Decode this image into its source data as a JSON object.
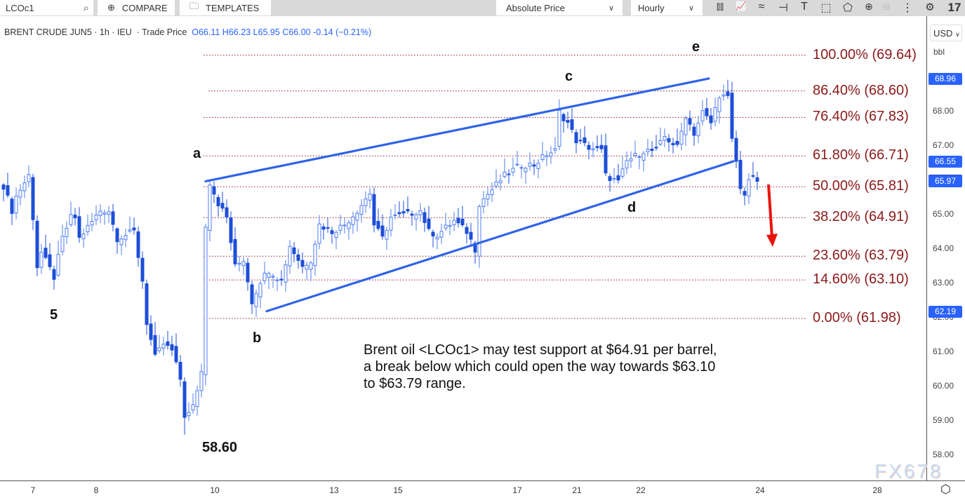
{
  "toolbar": {
    "symbol": "LCOc1",
    "compare": "COMPARE",
    "templates": "TEMPLATES",
    "price_mode": "Absolute Price",
    "interval": "Hourly",
    "icons": [
      "candlestick-icon",
      "indicator-icon",
      "studies-icon",
      "horizontal-line-icon",
      "text-icon",
      "rectangle-icon",
      "polygon-icon",
      "zoom-in-icon",
      "zoom-out-icon",
      "more-icon",
      "settings-icon",
      "tradingview-logo-icon"
    ]
  },
  "legend": {
    "name": "BRENT CRUDE JUN5",
    "interval": "1h",
    "exchange": "IEU",
    "type": "Trade Price",
    "open": "O66.11",
    "high": "H66.23",
    "low": "L65.95",
    "close": "C66.00",
    "change": "-0.14 (−0.21%)"
  },
  "price_axis": {
    "currency": "USD",
    "unit": "bbl",
    "ticks": [
      "68.00",
      "67.00",
      "66.00",
      "65.00",
      "64.00",
      "63.00",
      "62.00",
      "61.00",
      "60.00",
      "59.00",
      "58.00"
    ],
    "tags": [
      {
        "label": "68.96",
        "value": 68.96,
        "color": "#2962ff"
      },
      {
        "label": "66.55",
        "value": 66.55,
        "color": "#2962ff"
      },
      {
        "label": "66.00",
        "value": 66.0,
        "color": "#1e48c8"
      },
      {
        "label": "65.97",
        "value": 65.97,
        "color": "#2962ff"
      },
      {
        "label": "62.19",
        "value": 62.19,
        "color": "#2962ff"
      }
    ]
  },
  "time_axis": {
    "ticks": [
      "7",
      "8",
      "10",
      "13",
      "15",
      "17",
      "21",
      "22",
      "24",
      "28"
    ]
  },
  "chart_data": {
    "type": "candlestick",
    "title": "",
    "ylim": [
      57.6,
      70.3
    ],
    "close_path_note": "",
    "close_waypoints": [
      [
        0,
        65.84
      ],
      [
        2,
        65.12
      ],
      [
        3,
        65.53
      ],
      [
        6,
        66.14
      ],
      [
        7,
        64.92
      ],
      [
        8,
        63.49
      ],
      [
        9,
        63.9
      ],
      [
        12,
        63.18
      ],
      [
        14,
        64.31
      ],
      [
        16,
        64.92
      ],
      [
        17,
        64.92
      ],
      [
        18,
        64.31
      ],
      [
        23,
        65.12
      ],
      [
        25,
        65.12
      ],
      [
        27,
        64.31
      ],
      [
        31,
        64.51
      ],
      [
        33,
        63.08
      ],
      [
        34,
        61.86
      ],
      [
        36,
        60.84
      ],
      [
        38,
        61.24
      ],
      [
        40,
        61.04
      ],
      [
        42,
        60.22
      ],
      [
        43,
        59.0
      ],
      [
        45,
        59.41
      ],
      [
        47,
        60.43
      ],
      [
        48,
        64.71
      ],
      [
        49,
        65.94
      ],
      [
        51,
        65.33
      ],
      [
        53,
        64.92
      ],
      [
        55,
        63.49
      ],
      [
        57,
        63.69
      ],
      [
        59,
        62.47
      ],
      [
        61,
        63.08
      ],
      [
        63,
        63.39
      ],
      [
        66,
        63.08
      ],
      [
        68,
        64.1
      ],
      [
        71,
        63.49
      ],
      [
        73,
        63.69
      ],
      [
        75,
        64.71
      ],
      [
        78,
        64.51
      ],
      [
        81,
        64.71
      ],
      [
        84,
        65.12
      ],
      [
        87,
        65.63
      ],
      [
        88,
        64.71
      ],
      [
        90,
        64.31
      ],
      [
        92,
        64.92
      ],
      [
        96,
        65.02
      ],
      [
        99,
        65.12
      ],
      [
        101,
        64.51
      ],
      [
        103,
        64.41
      ],
      [
        107,
        64.82
      ],
      [
        110,
        64.51
      ],
      [
        112,
        64.0
      ],
      [
        113,
        65.33
      ],
      [
        116,
        65.73
      ],
      [
        119,
        66.14
      ],
      [
        123,
        66.45
      ],
      [
        126,
        66.45
      ],
      [
        129,
        66.76
      ],
      [
        131,
        66.86
      ],
      [
        132,
        67.98
      ],
      [
        134,
        67.67
      ],
      [
        136,
        67.16
      ],
      [
        139,
        66.96
      ],
      [
        142,
        66.86
      ],
      [
        143,
        66.14
      ],
      [
        146,
        65.94
      ],
      [
        148,
        66.55
      ],
      [
        152,
        66.86
      ],
      [
        155,
        66.86
      ],
      [
        157,
        67.27
      ],
      [
        160,
        66.96
      ],
      [
        162,
        67.88
      ],
      [
        164,
        67.37
      ],
      [
        166,
        67.98
      ],
      [
        168,
        67.67
      ],
      [
        170,
        68.49
      ],
      [
        172,
        68.39
      ],
      [
        173,
        67.16
      ],
      [
        174,
        66.55
      ],
      [
        175,
        65.73
      ],
      [
        176,
        65.63
      ],
      [
        177,
        66.04
      ],
      [
        179,
        66.0
      ]
    ],
    "low_point": 58.6,
    "up_color": "#4d7cf0",
    "down_color": "#1d4ed8",
    "channel": {
      "color": "#2f63e8",
      "upper": [
        [
          48,
          65.97
        ],
        [
          167.5,
          68.96
        ]
      ],
      "lower": [
        [
          62.5,
          62.19
        ],
        [
          173.3,
          66.55
        ]
      ]
    },
    "fib_levels": [
      {
        "label": "100.00% (69.64)",
        "value": 69.64
      },
      {
        "label": "86.40% (68.60)",
        "value": 68.6
      },
      {
        "label": "76.40% (67.83)",
        "value": 67.83
      },
      {
        "label": "61.80% (66.71)",
        "value": 66.71
      },
      {
        "label": "50.00% (65.81)",
        "value": 65.81
      },
      {
        "label": "38.20% (64.91)",
        "value": 64.91
      },
      {
        "label": "23.60% (63.79)",
        "value": 63.79
      },
      {
        "label": "14.60% (63.10)",
        "value": 63.1
      },
      {
        "label": "0.00% (61.98)",
        "value": 61.98
      }
    ],
    "fib_color": "#8b1a1a",
    "wave_labels": [
      "5",
      "a",
      "b",
      "c",
      "d",
      "e"
    ],
    "low_label": "58.60",
    "arrow": {
      "color": "#e8140c",
      "direction": "down"
    },
    "annotation": "Brent oil <LCOc1> may test support at $64.91 per barrel, a break below which could open the way towards $63.10 to $63.79 range."
  },
  "watermark": "FX678"
}
